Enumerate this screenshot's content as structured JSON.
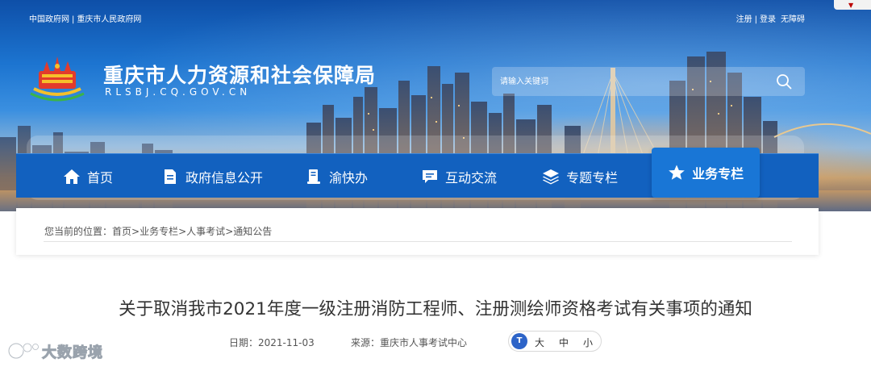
{
  "top_links": {
    "left": [
      "中国政府网",
      "重庆市人民政府网"
    ],
    "right": [
      "注册",
      "登录",
      "无障碍"
    ]
  },
  "site": {
    "title": "重庆市人力资源和社会保障局",
    "domain": "RLSBJ.CQ.GOV.CN"
  },
  "search": {
    "placeholder": "请输入关键词"
  },
  "nav": {
    "items": [
      {
        "label": "首页",
        "icon": "home-icon"
      },
      {
        "label": "政府信息公开",
        "icon": "document-icon"
      },
      {
        "label": "渝快办",
        "icon": "service-icon"
      },
      {
        "label": "互动交流",
        "icon": "chat-icon"
      },
      {
        "label": "专题专栏",
        "icon": "layers-icon"
      },
      {
        "label": "业务专栏",
        "icon": "star-icon",
        "active": true
      }
    ]
  },
  "breadcrumb": {
    "prefix": "您当前的位置：",
    "items": [
      "首页",
      "业务专栏",
      "人事考试",
      "通知公告"
    ],
    "separator": ">"
  },
  "article": {
    "title": "关于取消我市2021年度一级注册消防工程师、注册测绘师资格考试有关事项的通知",
    "date_label": "日期：",
    "date": "2021-11-03",
    "source_label": "来源：",
    "source": "重庆市人事考试中心"
  },
  "font_size": {
    "icon_text": "T",
    "options": [
      "大",
      "中",
      "小"
    ]
  },
  "watermark": {
    "text": "大数跨境"
  },
  "colors": {
    "nav_bg": "#1261bf",
    "nav_active": "#1976d6",
    "title_text": "#333333"
  }
}
